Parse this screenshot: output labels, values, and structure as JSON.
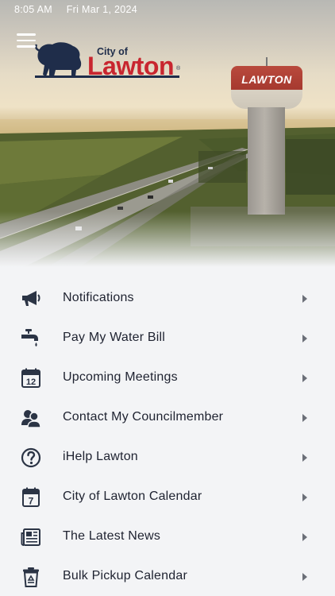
{
  "status_bar": {
    "time": "8:05 AM",
    "date": "Fri Mar 1, 2024"
  },
  "logo": {
    "city_of": "City of",
    "name": "Lawton",
    "reg": "®"
  },
  "hero": {
    "tower_text": "LAWTON"
  },
  "menu": {
    "items": [
      {
        "label": "Notifications",
        "icon": "megaphone-icon"
      },
      {
        "label": "Pay My Water Bill",
        "icon": "faucet-icon"
      },
      {
        "label": "Upcoming Meetings",
        "icon": "calendar-12-icon"
      },
      {
        "label": "Contact My Councilmember",
        "icon": "people-icon"
      },
      {
        "label": "iHelp Lawton",
        "icon": "help-circle-icon"
      },
      {
        "label": "City of Lawton Calendar",
        "icon": "calendar-7-icon"
      },
      {
        "label": "The Latest News",
        "icon": "newspaper-icon"
      },
      {
        "label": "Bulk Pickup Calendar",
        "icon": "recycle-bin-icon"
      }
    ],
    "calendar_numbers": {
      "meetings": "12",
      "city": "7"
    }
  },
  "colors": {
    "brand_red": "#c8262f",
    "brand_navy": "#1f2d4a",
    "icon": "#2b3445",
    "text": "#1e2230",
    "chevron": "#6b6f78",
    "background": "#f3f4f6"
  }
}
